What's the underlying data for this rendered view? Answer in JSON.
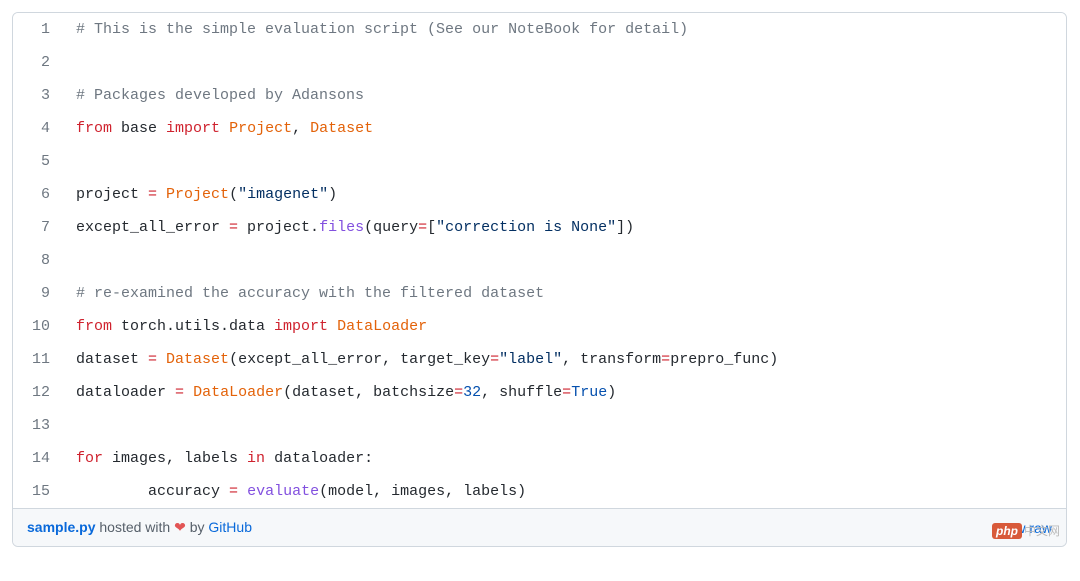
{
  "code": {
    "lines": [
      {
        "n": "1",
        "tokens": [
          {
            "t": "# This is the simple evaluation script (See our NoteBook for detail)",
            "cls": "c"
          }
        ]
      },
      {
        "n": "2",
        "tokens": []
      },
      {
        "n": "3",
        "tokens": [
          {
            "t": "# Packages developed by Adansons",
            "cls": "c"
          }
        ]
      },
      {
        "n": "4",
        "tokens": [
          {
            "t": "from",
            "cls": "kw"
          },
          {
            "t": " base ",
            "cls": "nm"
          },
          {
            "t": "import",
            "cls": "kw"
          },
          {
            "t": " ",
            "cls": "nm"
          },
          {
            "t": "Project",
            "cls": "cl"
          },
          {
            "t": ", ",
            "cls": "nm"
          },
          {
            "t": "Dataset",
            "cls": "cl"
          }
        ]
      },
      {
        "n": "5",
        "tokens": []
      },
      {
        "n": "6",
        "tokens": [
          {
            "t": "project ",
            "cls": "nm"
          },
          {
            "t": "=",
            "cls": "kw"
          },
          {
            "t": " ",
            "cls": "nm"
          },
          {
            "t": "Project",
            "cls": "cl"
          },
          {
            "t": "(",
            "cls": "nm"
          },
          {
            "t": "\"imagenet\"",
            "cls": "st"
          },
          {
            "t": ")",
            "cls": "nm"
          }
        ]
      },
      {
        "n": "7",
        "tokens": [
          {
            "t": "except_all_error ",
            "cls": "nm"
          },
          {
            "t": "=",
            "cls": "kw"
          },
          {
            "t": " project.",
            "cls": "nm"
          },
          {
            "t": "files",
            "cls": "fn"
          },
          {
            "t": "(",
            "cls": "nm"
          },
          {
            "t": "query",
            "cls": "nm"
          },
          {
            "t": "=",
            "cls": "kw"
          },
          {
            "t": "[",
            "cls": "nm"
          },
          {
            "t": "\"correction is None\"",
            "cls": "st"
          },
          {
            "t": "])",
            "cls": "nm"
          }
        ]
      },
      {
        "n": "8",
        "tokens": []
      },
      {
        "n": "9",
        "tokens": [
          {
            "t": "# re-examined the accuracy with the filtered dataset",
            "cls": "c"
          }
        ]
      },
      {
        "n": "10",
        "tokens": [
          {
            "t": "from",
            "cls": "kw"
          },
          {
            "t": " torch.utils.data ",
            "cls": "nm"
          },
          {
            "t": "import",
            "cls": "kw"
          },
          {
            "t": " ",
            "cls": "nm"
          },
          {
            "t": "DataLoader",
            "cls": "cl"
          }
        ]
      },
      {
        "n": "11",
        "tokens": [
          {
            "t": "dataset ",
            "cls": "nm"
          },
          {
            "t": "=",
            "cls": "kw"
          },
          {
            "t": " ",
            "cls": "nm"
          },
          {
            "t": "Dataset",
            "cls": "cl"
          },
          {
            "t": "(except_all_error, ",
            "cls": "nm"
          },
          {
            "t": "target_key",
            "cls": "nm"
          },
          {
            "t": "=",
            "cls": "kw"
          },
          {
            "t": "\"label\"",
            "cls": "st"
          },
          {
            "t": ", ",
            "cls": "nm"
          },
          {
            "t": "transform",
            "cls": "nm"
          },
          {
            "t": "=",
            "cls": "kw"
          },
          {
            "t": "prepro_func)",
            "cls": "nm"
          }
        ]
      },
      {
        "n": "12",
        "tokens": [
          {
            "t": "dataloader ",
            "cls": "nm"
          },
          {
            "t": "=",
            "cls": "kw"
          },
          {
            "t": " ",
            "cls": "nm"
          },
          {
            "t": "DataLoader",
            "cls": "cl"
          },
          {
            "t": "(dataset, ",
            "cls": "nm"
          },
          {
            "t": "batchsize",
            "cls": "nm"
          },
          {
            "t": "=",
            "cls": "kw"
          },
          {
            "t": "32",
            "cls": "num"
          },
          {
            "t": ", ",
            "cls": "nm"
          },
          {
            "t": "shuffle",
            "cls": "nm"
          },
          {
            "t": "=",
            "cls": "kw"
          },
          {
            "t": "True",
            "cls": "bool"
          },
          {
            "t": ")",
            "cls": "nm"
          }
        ]
      },
      {
        "n": "13",
        "tokens": []
      },
      {
        "n": "14",
        "tokens": [
          {
            "t": "for",
            "cls": "kw"
          },
          {
            "t": " images, labels ",
            "cls": "nm"
          },
          {
            "t": "in",
            "cls": "kw"
          },
          {
            "t": " dataloader:",
            "cls": "nm"
          }
        ]
      },
      {
        "n": "15",
        "tokens": [
          {
            "t": "        accuracy ",
            "cls": "nm"
          },
          {
            "t": "=",
            "cls": "kw"
          },
          {
            "t": " ",
            "cls": "nm"
          },
          {
            "t": "evaluate",
            "cls": "fn"
          },
          {
            "t": "(model, images, labels)",
            "cls": "nm"
          }
        ]
      }
    ]
  },
  "footer": {
    "filename": "sample.py",
    "hosted_with": " hosted with ",
    "heart": "❤",
    "by": " by ",
    "host": "GitHub",
    "view_raw": "view raw"
  },
  "watermark": {
    "logo": "php",
    "text": "中文网"
  }
}
